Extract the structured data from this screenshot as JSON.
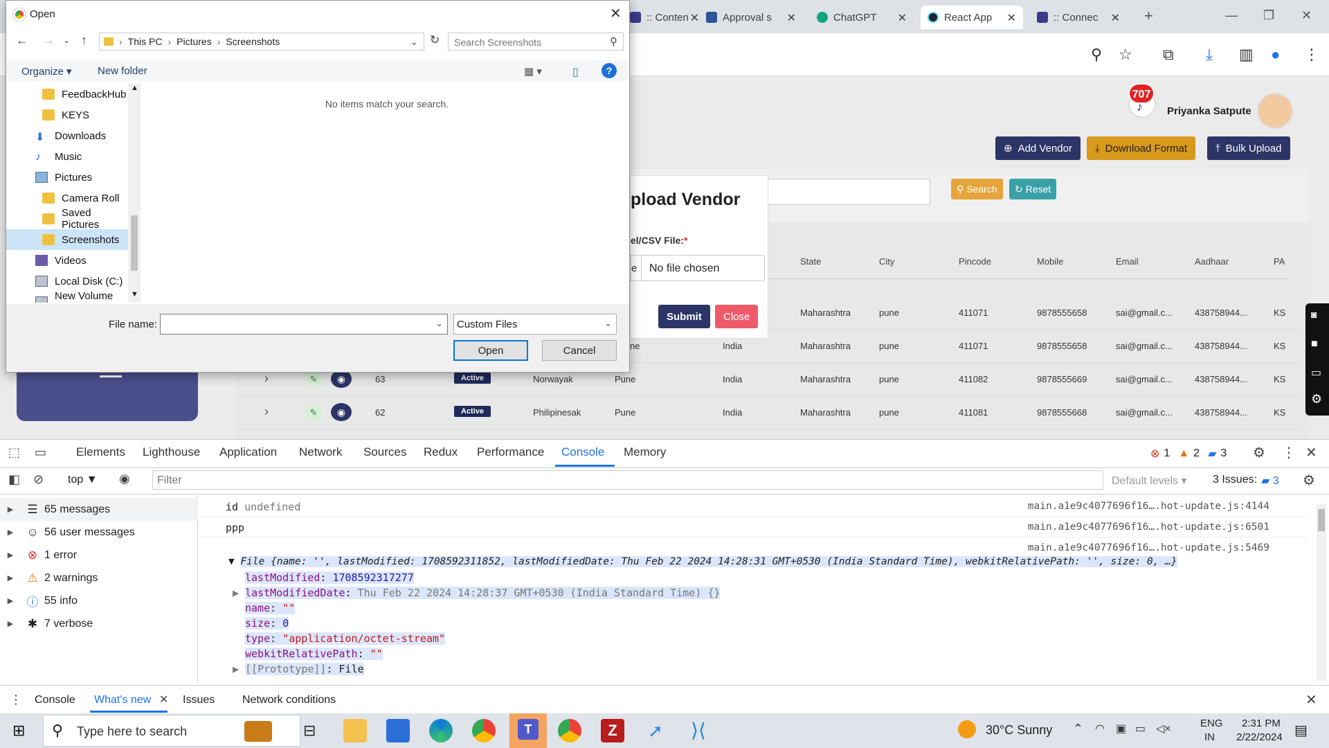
{
  "browser": {
    "tabs": [
      {
        "label": ":: Conten",
        "color": "#3c3c8c"
      },
      {
        "label": "Approval s",
        "color": "#2b579a"
      },
      {
        "label": "ChatGPT",
        "color": "#10a37f"
      },
      {
        "label": "React App",
        "color": "#20232a"
      },
      {
        "label": ":: Connec",
        "color": "#3c3c8c"
      }
    ],
    "new_tab": "+",
    "close": "✕"
  },
  "app": {
    "notification_count": "707",
    "user_name": "Priyanka Satpute",
    "buttons": {
      "add_vendor": "Add Vendor",
      "download_format": "Download Format",
      "bulk_upload": "Bulk Upload",
      "search": "Search",
      "reset": "Reset"
    },
    "columns": [
      "State",
      "City",
      "Pincode",
      "Mobile",
      "Email",
      "Aadhaar",
      "PA"
    ],
    "rows": [
      {
        "id": "",
        "status": "",
        "name": "",
        "city": "",
        "country": "",
        "state": "Maharashtra",
        "city2": "pune",
        "pincode": "411071",
        "mobile": "9878555658",
        "email": "sai@gmail.c...",
        "aadhaar": "438758944...",
        "pa": "KS"
      },
      {
        "id": "",
        "status": "",
        "name": "",
        "city": "ne",
        "country": "India",
        "state": "Maharashtra",
        "city2": "pune",
        "pincode": "411071",
        "mobile": "9878555658",
        "email": "sai@gmail.c...",
        "aadhaar": "438758944...",
        "pa": "KS"
      },
      {
        "id": "63",
        "status": "Active",
        "name": "Norwayak",
        "city": "Pune",
        "country": "India",
        "state": "Maharashtra",
        "city2": "pune",
        "pincode": "411082",
        "mobile": "9878555669",
        "email": "sai@gmail.c...",
        "aadhaar": "438758944...",
        "pa": "KS"
      },
      {
        "id": "62",
        "status": "Active",
        "name": "Philipinesak",
        "city": "Pune",
        "country": "India",
        "state": "Maharashtra",
        "city2": "pune",
        "pincode": "411081",
        "mobile": "9878555668",
        "email": "sai@gmail.c...",
        "aadhaar": "438758944...",
        "pa": "KS"
      }
    ],
    "modal": {
      "title": "pload Vendor",
      "label": "el/CSV File:",
      "required": "*",
      "file_prefix": "e",
      "file_placeholder": "No file chosen",
      "submit": "Submit",
      "close": "Close"
    }
  },
  "dialog": {
    "title": "Open",
    "breadcrumb": [
      "This PC",
      "Pictures",
      "Screenshots"
    ],
    "search_placeholder": "Search Screenshots",
    "organize": "Organize ▾",
    "new_folder": "New folder",
    "help": "?",
    "empty_message": "No items match your search.",
    "nav": [
      {
        "label": "FeedbackHub",
        "type": "folder"
      },
      {
        "label": "KEYS",
        "type": "folder"
      },
      {
        "label": "Downloads",
        "type": "download"
      },
      {
        "label": "Music",
        "type": "music"
      },
      {
        "label": "Pictures",
        "type": "pictures"
      },
      {
        "label": "Camera Roll",
        "type": "folder"
      },
      {
        "label": "Saved Pictures",
        "type": "folder"
      },
      {
        "label": "Screenshots",
        "type": "folder"
      },
      {
        "label": "Videos",
        "type": "videos"
      },
      {
        "label": "Local Disk (C:)",
        "type": "disk"
      },
      {
        "label": "New Volume (D:",
        "type": "disk"
      }
    ],
    "file_name_label": "File name:",
    "file_type": "Custom Files",
    "open": "Open",
    "cancel": "Cancel"
  },
  "devtools": {
    "tabs": [
      "Elements",
      "Lighthouse",
      "Application",
      "Network",
      "Sources",
      "Redux",
      "Performance",
      "Console",
      "Memory"
    ],
    "active_tab": "Console",
    "errors": "1",
    "warnings": "2",
    "messages_badge": "3",
    "context": "top",
    "filter_placeholder": "Filter",
    "default_levels": "Default levels",
    "issues_label": "3 Issues:",
    "issues_count": "3",
    "sidebar": [
      {
        "label": "65 messages",
        "icon": "list-icon"
      },
      {
        "label": "56 user messages",
        "icon": "user-icon"
      },
      {
        "label": "1 error",
        "icon": "error-icon"
      },
      {
        "label": "2 warnings",
        "icon": "warning-icon"
      },
      {
        "label": "55 info",
        "icon": "info-icon"
      },
      {
        "label": "7 verbose",
        "icon": "bug-icon"
      }
    ],
    "console": {
      "line1_key": "id",
      "line1_val": "undefined",
      "line1_src": "main.a1e9c4077696f16….hot-update.js:4144",
      "line2": "ppp",
      "line2_src": "main.a1e9c4077696f16….hot-update.js:6501",
      "line3_src": "main.a1e9c4077696f16….hot-update.js:5469",
      "file_summary": "File {name: '', lastModified: 1708592311852, lastModifiedDate: Thu Feb 22 2024 14:28:31 GMT+0530 (India Standard Time), webkitRelativePath: '', size: 0, …}",
      "props": [
        {
          "k": "lastModified",
          "v": "1708592317277",
          "cls": "n",
          "arrow": ""
        },
        {
          "k": "lastModifiedDate",
          "v": "Thu Feb 22 2024 14:28:37 GMT+0530 (India Standard Time) {}",
          "cls": "g",
          "arrow": "▶"
        },
        {
          "k": "name",
          "v": "\"\"",
          "cls": "s",
          "arrow": ""
        },
        {
          "k": "size",
          "v": "0",
          "cls": "n",
          "arrow": ""
        },
        {
          "k": "type",
          "v": "\"application/octet-stream\"",
          "cls": "s",
          "arrow": ""
        },
        {
          "k": "webkitRelativePath",
          "v": "\"\"",
          "cls": "s",
          "arrow": ""
        },
        {
          "k": "[[Prototype]]",
          "v": "File",
          "cls": "",
          "arrow": "▶"
        }
      ]
    },
    "drawer_tabs": [
      "Console",
      "What's new",
      "Issues",
      "Network conditions"
    ]
  },
  "taskbar": {
    "search_placeholder": "Type here to search",
    "weather": "30°C  Sunny",
    "lang1": "ENG",
    "lang2": "IN",
    "time": "2:31 PM",
    "date": "2/22/2024"
  }
}
